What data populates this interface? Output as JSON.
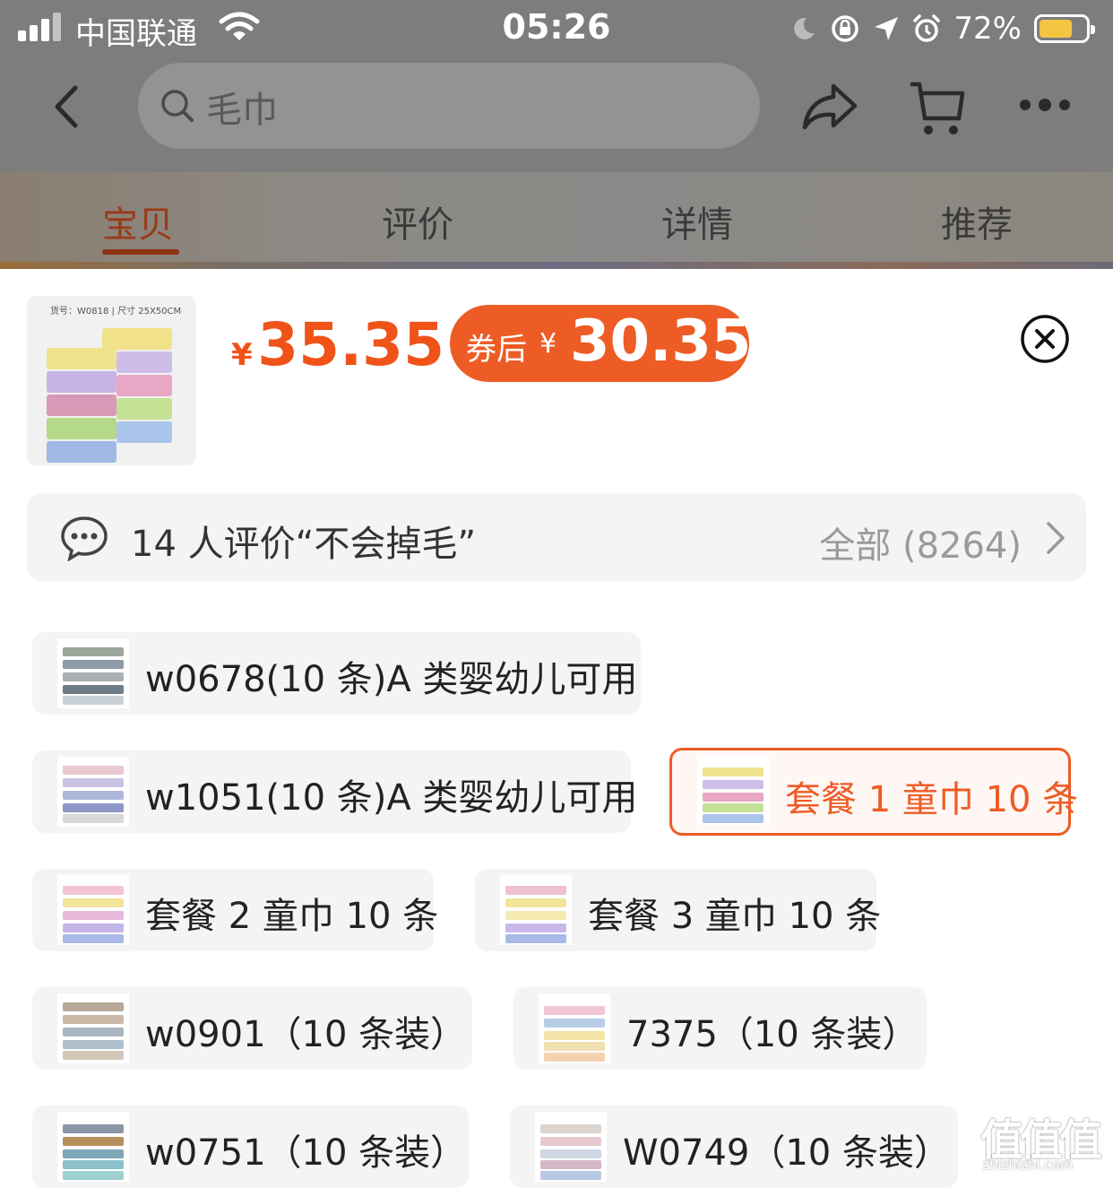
{
  "status_bar": {
    "carrier": "中国联通",
    "time": "05:26",
    "battery_percent": "72%",
    "battery_level": 0.72
  },
  "nav": {
    "search_text": "毛巾",
    "icons": [
      "back-icon",
      "search-icon",
      "share-icon",
      "cart-icon",
      "more-icon"
    ]
  },
  "tabs": [
    "宝贝",
    "评价",
    "详情",
    "推荐"
  ],
  "active_tab": 0,
  "product": {
    "thumb_caption": "货号：W0818 | 尺寸 25X50CM",
    "currency": "¥",
    "price": "35.35",
    "coupon_label": "券后",
    "coupon_price": "30.35"
  },
  "reviews": {
    "summary": "14 人评价“不会掉毛”",
    "all_label": "全部 (8264)"
  },
  "options": [
    {
      "label": "w0678(10 条)A 类婴幼儿可用",
      "selected": false
    },
    {
      "label": "w1051(10 条)A 类婴幼儿可用",
      "selected": false
    },
    {
      "label": "套餐 1 童巾 10 条",
      "selected": true
    },
    {
      "label": "套餐 2 童巾 10 条",
      "selected": false
    },
    {
      "label": "套餐 3 童巾 10 条",
      "selected": false
    },
    {
      "label": "w0901（10 条装）",
      "selected": false
    },
    {
      "label": "7375（10 条装）",
      "selected": false
    },
    {
      "label": "w0751（10 条装）",
      "selected": false
    },
    {
      "label": "W0749（10 条装）",
      "selected": false
    }
  ],
  "watermark": {
    "mark": "值值值",
    "site": "zhizhizhi.com"
  },
  "colors": {
    "accent": "#ee5c26",
    "price": "#f05318"
  }
}
